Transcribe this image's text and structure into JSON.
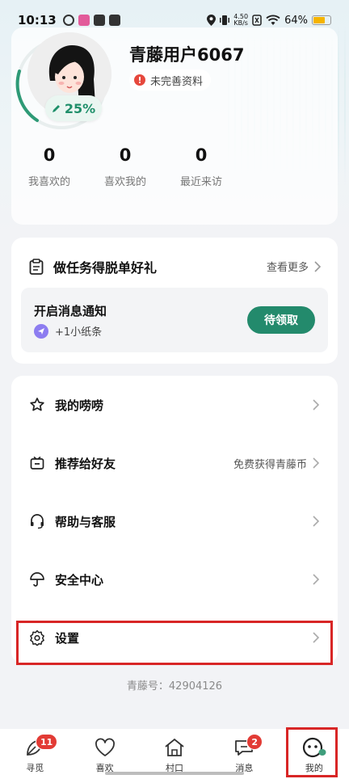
{
  "status_bar": {
    "time": "10:13",
    "net_speed_value": "4.50",
    "net_speed_unit": "KB/s",
    "battery": "64%"
  },
  "profile": {
    "username": "青藤用户6067",
    "incomplete_label": "未完善资料",
    "completion": "25%",
    "completion_fraction": 0.25,
    "stats": [
      {
        "value": "0",
        "label": "我喜欢的"
      },
      {
        "value": "0",
        "label": "喜欢我的"
      },
      {
        "value": "0",
        "label": "最近来访"
      }
    ]
  },
  "task": {
    "title": "做任务得脱单好礼",
    "see_more": "查看更多",
    "notify_title": "开启消息通知",
    "notify_reward": "+1小纸条",
    "claim_button": "待领取"
  },
  "menu": {
    "items": [
      {
        "label": "我的唠唠",
        "right": "",
        "icon": "star-icon"
      },
      {
        "label": "推荐给好友",
        "right": "免费获得青藤币",
        "icon": "gift-icon"
      },
      {
        "label": "帮助与客服",
        "right": "",
        "icon": "headset-icon"
      },
      {
        "label": "安全中心",
        "right": "",
        "icon": "umbrella-icon"
      },
      {
        "label": "设置",
        "right": "",
        "icon": "gear-icon"
      }
    ]
  },
  "account_id": "青藤号：42904126",
  "nav": {
    "items": [
      {
        "label": "寻觅",
        "badge": "11",
        "icon": "leaf-icon"
      },
      {
        "label": "喜欢",
        "badge": "",
        "icon": "heart-icon"
      },
      {
        "label": "村口",
        "badge": "",
        "icon": "house-icon"
      },
      {
        "label": "消息",
        "badge": "2",
        "icon": "chat-icon"
      },
      {
        "label": "我的",
        "badge": "",
        "icon": "face-icon"
      }
    ]
  },
  "colors": {
    "accent_green": "#238a6c",
    "badge_red": "#e23b35",
    "highlight_red": "#d82626"
  }
}
